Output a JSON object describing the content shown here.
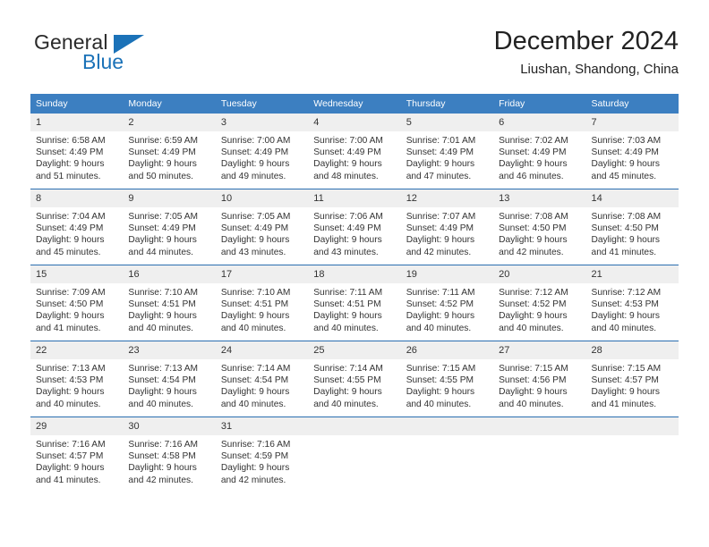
{
  "logo": {
    "line1": "General",
    "line2": "Blue",
    "triangle_color": "#1b72b8",
    "text_color": "#2a2a2a"
  },
  "header": {
    "title": "December 2024",
    "subtitle": "Liushan, Shandong, China"
  },
  "colors": {
    "header_bg": "#3c7fc1",
    "header_text": "#ffffff",
    "daynum_bg": "#efefef",
    "row_divider": "#2a6eb0",
    "body_text": "#333333"
  },
  "weekday_headers": [
    "Sunday",
    "Monday",
    "Tuesday",
    "Wednesday",
    "Thursday",
    "Friday",
    "Saturday"
  ],
  "weeks": [
    [
      {
        "day": "1",
        "sunrise": "Sunrise: 6:58 AM",
        "sunset": "Sunset: 4:49 PM",
        "daylight1": "Daylight: 9 hours",
        "daylight2": "and 51 minutes."
      },
      {
        "day": "2",
        "sunrise": "Sunrise: 6:59 AM",
        "sunset": "Sunset: 4:49 PM",
        "daylight1": "Daylight: 9 hours",
        "daylight2": "and 50 minutes."
      },
      {
        "day": "3",
        "sunrise": "Sunrise: 7:00 AM",
        "sunset": "Sunset: 4:49 PM",
        "daylight1": "Daylight: 9 hours",
        "daylight2": "and 49 minutes."
      },
      {
        "day": "4",
        "sunrise": "Sunrise: 7:00 AM",
        "sunset": "Sunset: 4:49 PM",
        "daylight1": "Daylight: 9 hours",
        "daylight2": "and 48 minutes."
      },
      {
        "day": "5",
        "sunrise": "Sunrise: 7:01 AM",
        "sunset": "Sunset: 4:49 PM",
        "daylight1": "Daylight: 9 hours",
        "daylight2": "and 47 minutes."
      },
      {
        "day": "6",
        "sunrise": "Sunrise: 7:02 AM",
        "sunset": "Sunset: 4:49 PM",
        "daylight1": "Daylight: 9 hours",
        "daylight2": "and 46 minutes."
      },
      {
        "day": "7",
        "sunrise": "Sunrise: 7:03 AM",
        "sunset": "Sunset: 4:49 PM",
        "daylight1": "Daylight: 9 hours",
        "daylight2": "and 45 minutes."
      }
    ],
    [
      {
        "day": "8",
        "sunrise": "Sunrise: 7:04 AM",
        "sunset": "Sunset: 4:49 PM",
        "daylight1": "Daylight: 9 hours",
        "daylight2": "and 45 minutes."
      },
      {
        "day": "9",
        "sunrise": "Sunrise: 7:05 AM",
        "sunset": "Sunset: 4:49 PM",
        "daylight1": "Daylight: 9 hours",
        "daylight2": "and 44 minutes."
      },
      {
        "day": "10",
        "sunrise": "Sunrise: 7:05 AM",
        "sunset": "Sunset: 4:49 PM",
        "daylight1": "Daylight: 9 hours",
        "daylight2": "and 43 minutes."
      },
      {
        "day": "11",
        "sunrise": "Sunrise: 7:06 AM",
        "sunset": "Sunset: 4:49 PM",
        "daylight1": "Daylight: 9 hours",
        "daylight2": "and 43 minutes."
      },
      {
        "day": "12",
        "sunrise": "Sunrise: 7:07 AM",
        "sunset": "Sunset: 4:49 PM",
        "daylight1": "Daylight: 9 hours",
        "daylight2": "and 42 minutes."
      },
      {
        "day": "13",
        "sunrise": "Sunrise: 7:08 AM",
        "sunset": "Sunset: 4:50 PM",
        "daylight1": "Daylight: 9 hours",
        "daylight2": "and 42 minutes."
      },
      {
        "day": "14",
        "sunrise": "Sunrise: 7:08 AM",
        "sunset": "Sunset: 4:50 PM",
        "daylight1": "Daylight: 9 hours",
        "daylight2": "and 41 minutes."
      }
    ],
    [
      {
        "day": "15",
        "sunrise": "Sunrise: 7:09 AM",
        "sunset": "Sunset: 4:50 PM",
        "daylight1": "Daylight: 9 hours",
        "daylight2": "and 41 minutes."
      },
      {
        "day": "16",
        "sunrise": "Sunrise: 7:10 AM",
        "sunset": "Sunset: 4:51 PM",
        "daylight1": "Daylight: 9 hours",
        "daylight2": "and 40 minutes."
      },
      {
        "day": "17",
        "sunrise": "Sunrise: 7:10 AM",
        "sunset": "Sunset: 4:51 PM",
        "daylight1": "Daylight: 9 hours",
        "daylight2": "and 40 minutes."
      },
      {
        "day": "18",
        "sunrise": "Sunrise: 7:11 AM",
        "sunset": "Sunset: 4:51 PM",
        "daylight1": "Daylight: 9 hours",
        "daylight2": "and 40 minutes."
      },
      {
        "day": "19",
        "sunrise": "Sunrise: 7:11 AM",
        "sunset": "Sunset: 4:52 PM",
        "daylight1": "Daylight: 9 hours",
        "daylight2": "and 40 minutes."
      },
      {
        "day": "20",
        "sunrise": "Sunrise: 7:12 AM",
        "sunset": "Sunset: 4:52 PM",
        "daylight1": "Daylight: 9 hours",
        "daylight2": "and 40 minutes."
      },
      {
        "day": "21",
        "sunrise": "Sunrise: 7:12 AM",
        "sunset": "Sunset: 4:53 PM",
        "daylight1": "Daylight: 9 hours",
        "daylight2": "and 40 minutes."
      }
    ],
    [
      {
        "day": "22",
        "sunrise": "Sunrise: 7:13 AM",
        "sunset": "Sunset: 4:53 PM",
        "daylight1": "Daylight: 9 hours",
        "daylight2": "and 40 minutes."
      },
      {
        "day": "23",
        "sunrise": "Sunrise: 7:13 AM",
        "sunset": "Sunset: 4:54 PM",
        "daylight1": "Daylight: 9 hours",
        "daylight2": "and 40 minutes."
      },
      {
        "day": "24",
        "sunrise": "Sunrise: 7:14 AM",
        "sunset": "Sunset: 4:54 PM",
        "daylight1": "Daylight: 9 hours",
        "daylight2": "and 40 minutes."
      },
      {
        "day": "25",
        "sunrise": "Sunrise: 7:14 AM",
        "sunset": "Sunset: 4:55 PM",
        "daylight1": "Daylight: 9 hours",
        "daylight2": "and 40 minutes."
      },
      {
        "day": "26",
        "sunrise": "Sunrise: 7:15 AM",
        "sunset": "Sunset: 4:55 PM",
        "daylight1": "Daylight: 9 hours",
        "daylight2": "and 40 minutes."
      },
      {
        "day": "27",
        "sunrise": "Sunrise: 7:15 AM",
        "sunset": "Sunset: 4:56 PM",
        "daylight1": "Daylight: 9 hours",
        "daylight2": "and 40 minutes."
      },
      {
        "day": "28",
        "sunrise": "Sunrise: 7:15 AM",
        "sunset": "Sunset: 4:57 PM",
        "daylight1": "Daylight: 9 hours",
        "daylight2": "and 41 minutes."
      }
    ],
    [
      {
        "day": "29",
        "sunrise": "Sunrise: 7:16 AM",
        "sunset": "Sunset: 4:57 PM",
        "daylight1": "Daylight: 9 hours",
        "daylight2": "and 41 minutes."
      },
      {
        "day": "30",
        "sunrise": "Sunrise: 7:16 AM",
        "sunset": "Sunset: 4:58 PM",
        "daylight1": "Daylight: 9 hours",
        "daylight2": "and 42 minutes."
      },
      {
        "day": "31",
        "sunrise": "Sunrise: 7:16 AM",
        "sunset": "Sunset: 4:59 PM",
        "daylight1": "Daylight: 9 hours",
        "daylight2": "and 42 minutes."
      },
      {
        "day": "",
        "sunrise": "",
        "sunset": "",
        "daylight1": "",
        "daylight2": ""
      },
      {
        "day": "",
        "sunrise": "",
        "sunset": "",
        "daylight1": "",
        "daylight2": ""
      },
      {
        "day": "",
        "sunrise": "",
        "sunset": "",
        "daylight1": "",
        "daylight2": ""
      },
      {
        "day": "",
        "sunrise": "",
        "sunset": "",
        "daylight1": "",
        "daylight2": ""
      }
    ]
  ]
}
